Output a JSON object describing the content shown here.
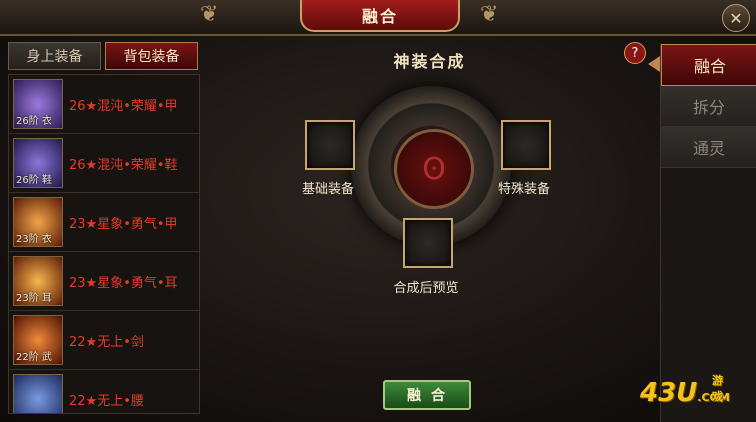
{
  "window": {
    "title": "融合"
  },
  "left_tabs": [
    {
      "label": "身上装备",
      "active": false
    },
    {
      "label": "背包装备",
      "active": true
    }
  ],
  "items": [
    {
      "tier": "26阶",
      "slot": "衣",
      "name": "26★混沌•荣耀•甲",
      "color": "#5a3fa8"
    },
    {
      "tier": "26阶",
      "slot": "鞋",
      "name": "26★混沌•荣耀•鞋",
      "color": "#4a3a9a"
    },
    {
      "tier": "23阶",
      "slot": "衣",
      "name": "23★星象•勇气•甲",
      "color": "#c2541a"
    },
    {
      "tier": "23阶",
      "slot": "耳",
      "name": "23★星象•勇气•耳",
      "color": "#c8601c"
    },
    {
      "tier": "22阶",
      "slot": "武",
      "name": "22★无上•剑",
      "color": "#b6401a"
    },
    {
      "tier": "",
      "slot": "",
      "name": "22★无上•腰",
      "color": "#3a5aa0"
    }
  ],
  "main": {
    "title": "神装合成",
    "base_slot_label": "基础装备",
    "special_slot_label": "特殊装备",
    "preview_label": "合成后预览",
    "fuse_button": "融合",
    "help_icon": "?"
  },
  "side_tabs": [
    {
      "label": "融合",
      "active": true
    },
    {
      "label": "拆分",
      "active": false
    },
    {
      "label": "通灵",
      "active": false
    }
  ],
  "watermark": {
    "text": "43U",
    "sub": "游戏",
    "domain": ".COM"
  },
  "close_icon": "✕"
}
